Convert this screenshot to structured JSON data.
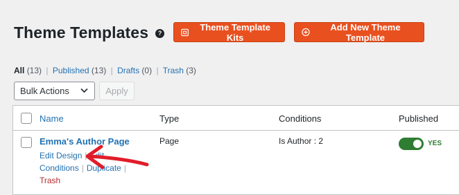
{
  "header": {
    "title": "Theme Templates",
    "help_icon": "question-circle-icon",
    "buttons": {
      "kits_label": "Theme Template Kits",
      "add_label": "Add New Theme Template"
    }
  },
  "filters": {
    "all": "All",
    "all_count": "(13)",
    "published": "Published",
    "published_count": "(13)",
    "drafts": "Drafts",
    "drafts_count": "(0)",
    "trash": "Trash",
    "trash_count": "(3)"
  },
  "bulk": {
    "selected": "Bulk Actions",
    "apply_label": "Apply"
  },
  "table": {
    "columns": [
      "Name",
      "Type",
      "Conditions",
      "Published"
    ],
    "rows": [
      {
        "name": "Emma's Author Page",
        "type": "Page",
        "conditions": "Is Author : 2",
        "published": "YES",
        "actions": {
          "edit_design": "Edit Design",
          "edit": "Edit",
          "conditions": "Conditions",
          "duplicate": "Duplicate",
          "trash": "Trash"
        }
      }
    ]
  },
  "colors": {
    "brand_orange": "#e9501f",
    "link_blue": "#2271b1",
    "toggle_green": "#2e7d32",
    "annotation_red": "#e11d2a"
  }
}
